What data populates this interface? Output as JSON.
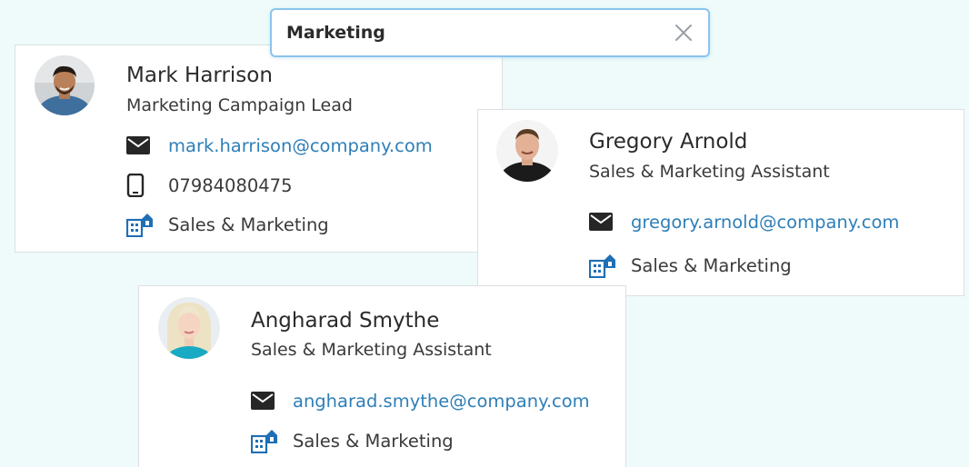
{
  "search": {
    "value": "Marketing",
    "clear_icon": "close-icon"
  },
  "contacts": [
    {
      "name": "Mark Harrison",
      "title": "Marketing Campaign Lead",
      "email": "mark.harrison@company.com",
      "phone": "07984080475",
      "department": "Sales & Marketing"
    },
    {
      "name": "Gregory Arnold",
      "title": "Sales & Marketing Assistant",
      "email": "gregory.arnold@company.com",
      "department": "Sales & Marketing"
    },
    {
      "name": "Angharad Smythe",
      "title": "Sales & Marketing Assistant",
      "email": "angharad.smythe@company.com",
      "department": "Sales & Marketing"
    }
  ],
  "colors": {
    "background": "#eefbfa",
    "link": "#2f7fb8",
    "department_icon": "#1f6fb5",
    "search_border": "#8ac4ef"
  }
}
